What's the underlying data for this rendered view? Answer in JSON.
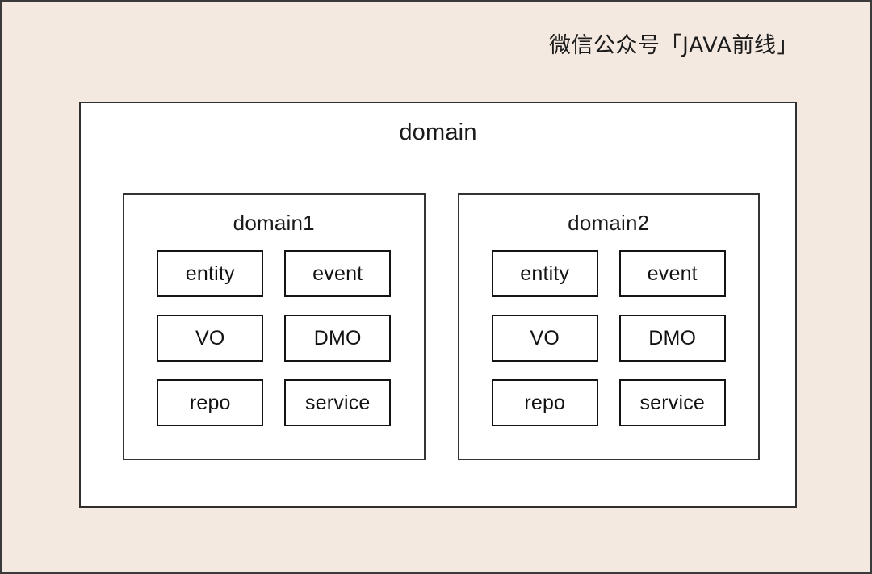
{
  "header": {
    "title": "微信公众号「JAVA前线」"
  },
  "diagram": {
    "root": {
      "label": "domain"
    },
    "subdomains": [
      {
        "label": "domain1",
        "items": [
          "entity",
          "event",
          "VO",
          "DMO",
          "repo",
          "service"
        ]
      },
      {
        "label": "domain2",
        "items": [
          "entity",
          "event",
          "VO",
          "DMO",
          "repo",
          "service"
        ]
      }
    ]
  },
  "colors": {
    "canvas_background": "#f3e9e0",
    "canvas_border": "#3a3a3a",
    "box_background": "#ffffff",
    "domain_border": "#2f2f2f",
    "subdomain_border": "#333333",
    "item_border": "#141414",
    "text": "#1a1a1a"
  }
}
